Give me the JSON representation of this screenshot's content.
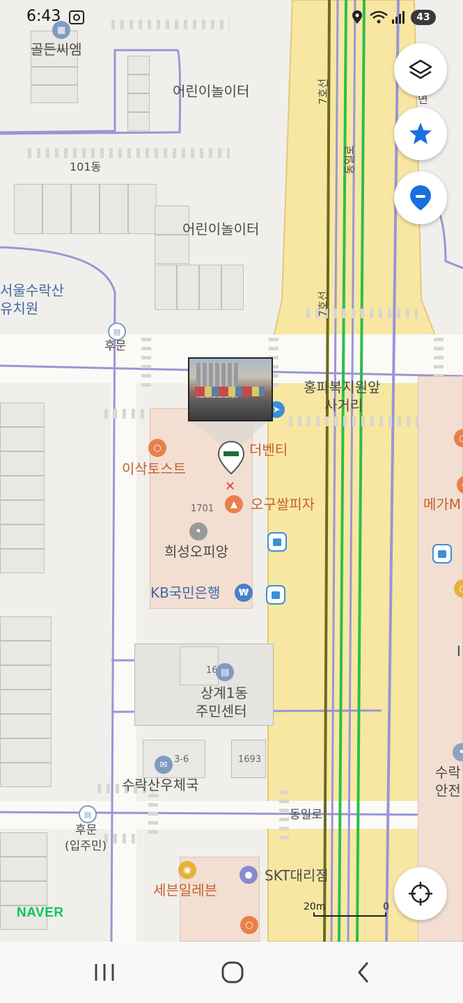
{
  "status_bar": {
    "time": "6:43",
    "battery": "43"
  },
  "map_labels": {
    "golden_cm": "골든씨엠",
    "playground_1": "어린이놀이터",
    "dong_101": "101동",
    "playground_2": "어린이놀이터",
    "kindergarten_line1": "서울수락산",
    "kindergarten_line2": "유치원",
    "back_gate": "후문",
    "line7_top": "7호선",
    "line7_mid": "7호선",
    "dongil_ro_vertical": "동일로",
    "myeon": "면",
    "hongpa_line1": "홍파복지원앞",
    "hongpa_line2": "사거리",
    "isak_toast": "이삭토스트",
    "the_venti": "더벤티",
    "oguppal_pizza": "오구쌀피자",
    "num_1701": "1701",
    "huiseong_opian": "희성오피앙",
    "kb_bank": "KB국민은행",
    "mega": "메가M",
    "num_16": "16",
    "sanggye_line1": "상계1동",
    "sanggye_line2": "주민센터",
    "num_3_6": "3-6",
    "num_1693": "1693",
    "post_office": "수락산우체국",
    "dongil_ro_horizontal": "동일로",
    "back_gate2_line1": "후문",
    "back_gate2_line2": "(입주민)",
    "sura_right_line1": "수락",
    "sura_right_line2": "안전",
    "seven_eleven": "세븐일레븐",
    "skt_agency": "SKT대리점",
    "right_edge_char": "I"
  },
  "scale": {
    "left": "20m",
    "right": "0"
  },
  "brand": "NAVER",
  "icons": {
    "layers": "layers-icon",
    "favorites": "star-icon",
    "place": "location-pin-icon",
    "locate": "crosshair-icon"
  },
  "colors": {
    "road_main": "#f7e7a3",
    "subway_line7": "#6b6b1e",
    "green_line": "#2ebd4a",
    "road_outline": "#9b95d6",
    "accent_blue": "#1a6fe0",
    "naver_green": "#03c75a"
  }
}
